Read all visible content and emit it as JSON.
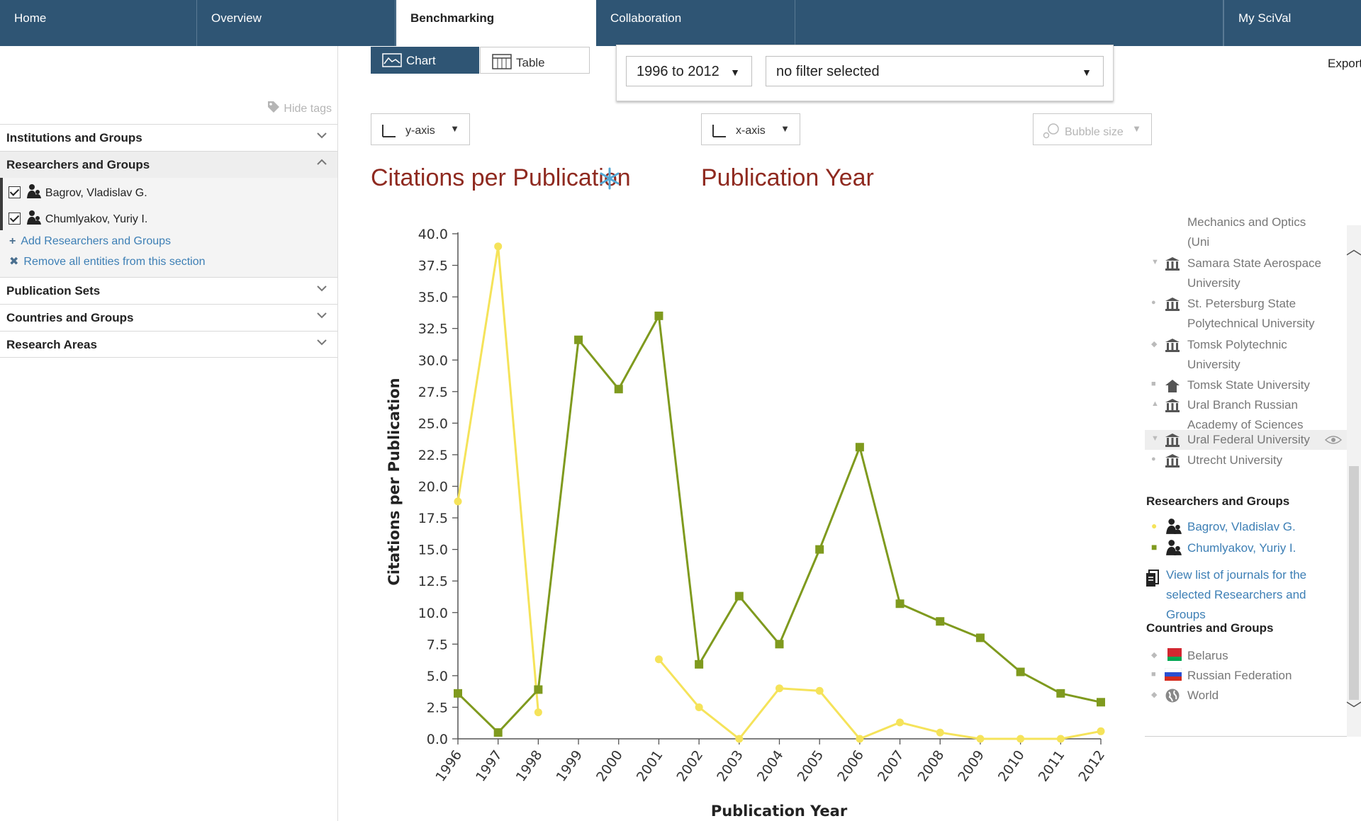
{
  "nav": {
    "tabs": [
      {
        "label": "Home"
      },
      {
        "label": "Overview"
      },
      {
        "label": "Benchmarking"
      },
      {
        "label": "Collaboration"
      },
      {
        "label": "My SciVal"
      }
    ]
  },
  "sidebar": {
    "hide_tags": "Hide tags",
    "sections": [
      {
        "label": "Institutions and Groups"
      },
      {
        "label": "Researchers and Groups"
      },
      {
        "label": "Publication Sets"
      },
      {
        "label": "Countries and Groups"
      },
      {
        "label": "Research Areas"
      }
    ],
    "researchers": [
      {
        "name": "Bagrov, Vladislav G."
      },
      {
        "name": "Chumlyakov, Yuriy I."
      }
    ],
    "add_link": "Add Researchers and Groups",
    "remove_link": "Remove all entities from this section"
  },
  "controls": {
    "chart_label": "Chart",
    "table_label": "Table",
    "year_range": "1996 to 2012",
    "filter": "no filter selected",
    "export": "Export",
    "y_axis_btn": "y-axis",
    "x_axis_btn": "x-axis",
    "bubble_btn": "Bubble size",
    "y_metric": "Citations per Publication",
    "x_metric": "Publication Year"
  },
  "chart_data": {
    "type": "line",
    "xlabel": "Publication Year",
    "ylabel": "Citations per Publication",
    "ylim": [
      0,
      40
    ],
    "yticks": [
      "0.0",
      "2.5",
      "5.0",
      "7.5",
      "10.0",
      "12.5",
      "15.0",
      "17.5",
      "20.0",
      "22.5",
      "25.0",
      "27.5",
      "30.0",
      "32.5",
      "35.0",
      "37.5",
      "40.0"
    ],
    "categories": [
      "1996",
      "1997",
      "1998",
      "1999",
      "2000",
      "2001",
      "2002",
      "2003",
      "2004",
      "2005",
      "2006",
      "2007",
      "2008",
      "2009",
      "2010",
      "2011",
      "2012"
    ],
    "series": [
      {
        "name": "Bagrov, Vladislav G.",
        "color": "#f5e35a",
        "marker": "circle",
        "values": [
          18.8,
          39.0,
          2.1,
          null,
          null,
          6.3,
          2.5,
          0.0,
          4.0,
          3.8,
          0.0,
          1.3,
          0.5,
          0.0,
          0.0,
          0.0,
          0.6
        ]
      },
      {
        "name": "Chumlyakov, Yuriy I.",
        "color": "#7f9a1e",
        "marker": "square",
        "values": [
          3.6,
          0.5,
          3.9,
          31.6,
          27.7,
          33.5,
          5.9,
          11.3,
          7.5,
          15.0,
          23.1,
          10.7,
          9.3,
          8.0,
          5.3,
          3.6,
          2.9
        ]
      }
    ],
    "grid": false
  },
  "legend": {
    "institutions": [
      {
        "lines": [
          "Mechanics and Optics",
          "(Uni"
        ],
        "marker": ""
      },
      {
        "lines": [
          "Samara State Aerospace",
          "University"
        ],
        "marker": "▼"
      },
      {
        "lines": [
          "St. Petersburg State",
          "Polytechnical University"
        ],
        "marker": "●"
      },
      {
        "lines": [
          "Tomsk Polytechnic",
          "University"
        ],
        "marker": "◆"
      },
      {
        "lines": [
          "Tomsk State University"
        ],
        "marker": "■"
      },
      {
        "lines": [
          "Ural Branch Russian",
          "Academy of Sciences"
        ],
        "marker": "▲"
      },
      {
        "lines": [
          "Ural Federal University"
        ],
        "marker": "▼"
      },
      {
        "lines": [
          "Utrecht University"
        ],
        "marker": "●"
      }
    ],
    "researchers_header": "Researchers and Groups",
    "researchers": [
      {
        "name": "Bagrov, Vladislav G."
      },
      {
        "name": "Chumlyakov, Yuriy I."
      }
    ],
    "journals_link": [
      "View list of journals for the",
      "selected Researchers and Groups"
    ],
    "countries_header": "Countries and Groups",
    "countries": [
      {
        "name": "Belarus"
      },
      {
        "name": "Russian Federation"
      },
      {
        "name": "World"
      }
    ]
  }
}
